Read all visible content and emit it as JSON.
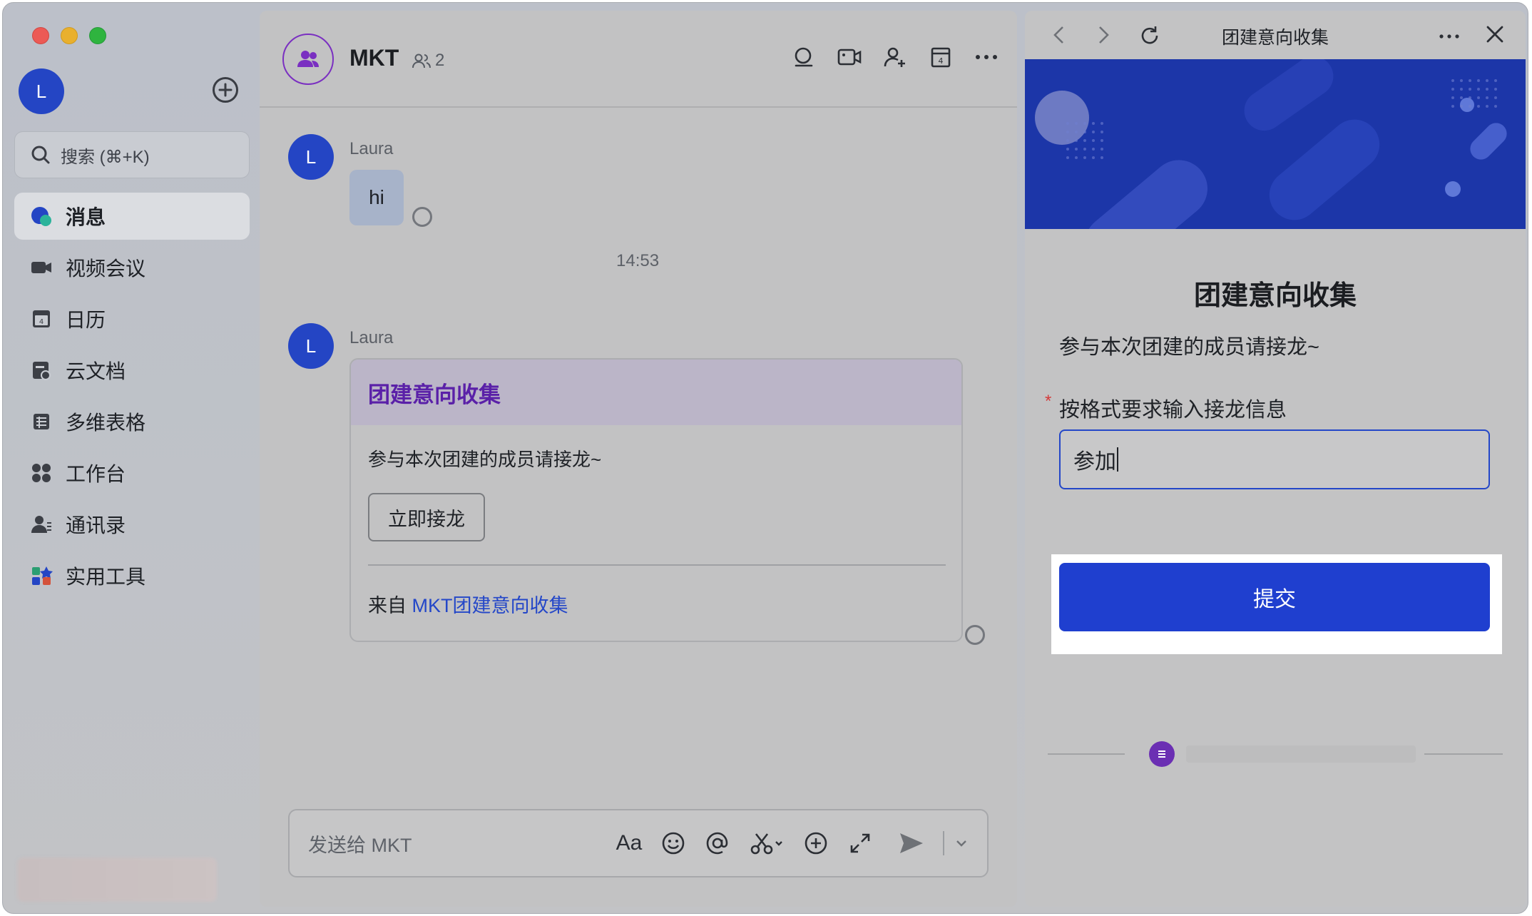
{
  "sidebar": {
    "avatar_initial": "L",
    "search_placeholder": "搜索 (⌘+K)",
    "items": [
      {
        "label": "消息",
        "icon": "message-icon",
        "active": true
      },
      {
        "label": "视频会议",
        "icon": "video-meeting-icon",
        "active": false
      },
      {
        "label": "日历",
        "icon": "calendar-icon",
        "active": false
      },
      {
        "label": "云文档",
        "icon": "cloud-doc-icon",
        "active": false
      },
      {
        "label": "多维表格",
        "icon": "table-icon",
        "active": false
      },
      {
        "label": "工作台",
        "icon": "workplace-icon",
        "active": false
      },
      {
        "label": "通讯录",
        "icon": "contacts-icon",
        "active": false
      },
      {
        "label": "实用工具",
        "icon": "tools-icon",
        "active": false
      }
    ]
  },
  "chat": {
    "group_name": "MKT",
    "member_count": "2",
    "messages": [
      {
        "sender": "Laura",
        "avatar": "L",
        "text": "hi"
      },
      {
        "sender": "Laura",
        "avatar": "L"
      }
    ],
    "timestamp": "14:53",
    "card": {
      "title": "团建意向收集",
      "description": "参与本次团建的成员请接龙~",
      "button": "立即接龙",
      "source_prefix": "来自 ",
      "source_link": "MKT团建意向收集"
    },
    "composer_placeholder": "发送给 MKT",
    "composer_format_label": "Aa"
  },
  "panel": {
    "title": "团建意向收集",
    "form_title": "团建意向收集",
    "form_description": "参与本次团建的成员请接龙~",
    "required_mark": "*",
    "field_label": "按格式要求输入接龙信息",
    "field_value": "参加",
    "submit_label": "提交"
  },
  "colors": {
    "accent": "#1f3fcf",
    "avatar": "#2445c4",
    "card_title": "#5a20a8",
    "link": "#2447c8",
    "banner": "#1c36a8"
  }
}
